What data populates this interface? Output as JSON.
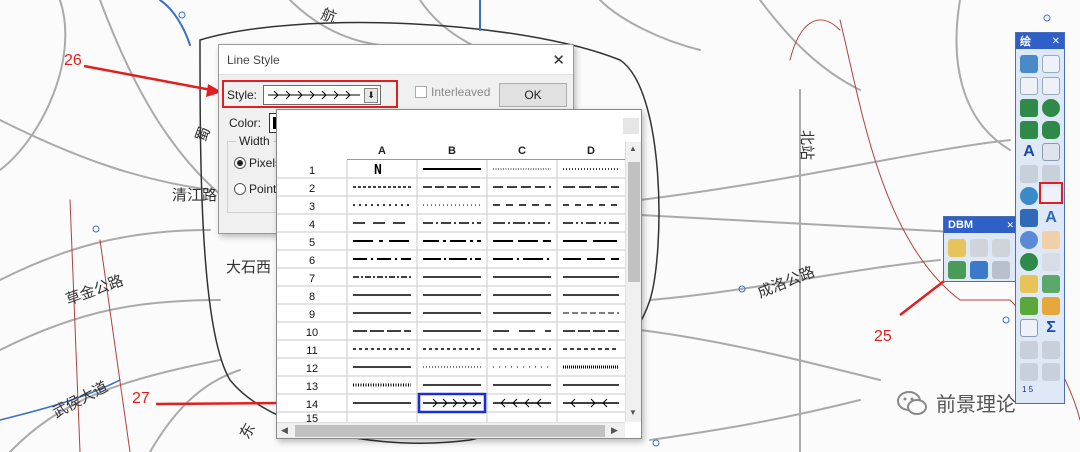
{
  "map": {
    "labels": [
      "清江路",
      "大石西",
      "草金公路",
      "成洛公路",
      "武侯大道",
      "航",
      "蜀",
      "北站",
      "东"
    ],
    "bg": "#fbfbfb",
    "road_gray": "#aaaaaa",
    "road_blue": "#3a6fc8",
    "road_red": "#b04040"
  },
  "dialog": {
    "title": "Line Style",
    "style_label": "Style:",
    "interleaved_label": "Interleaved",
    "ok_label": "OK",
    "color_label": "Color:",
    "width_group_label": "Width",
    "width_options": [
      "Pixels",
      "Points"
    ]
  },
  "style_grid": {
    "columns": [
      "A",
      "B",
      "C",
      "D"
    ],
    "rows": [
      "1",
      "2",
      "3",
      "4",
      "5",
      "6",
      "7",
      "8",
      "9",
      "10",
      "11",
      "12",
      "13",
      "14",
      "15"
    ],
    "first_cell_symbol": "N"
  },
  "toolbar_main": {
    "title": "绘",
    "close": "✕",
    "bottom_label": "1 5"
  },
  "toolbar_dbm": {
    "title": "DBM"
  },
  "annotations": {
    "a26": "26",
    "a25": "25",
    "a27": "27",
    "color": "#e02020"
  },
  "watermark": {
    "text": "前景理论"
  }
}
